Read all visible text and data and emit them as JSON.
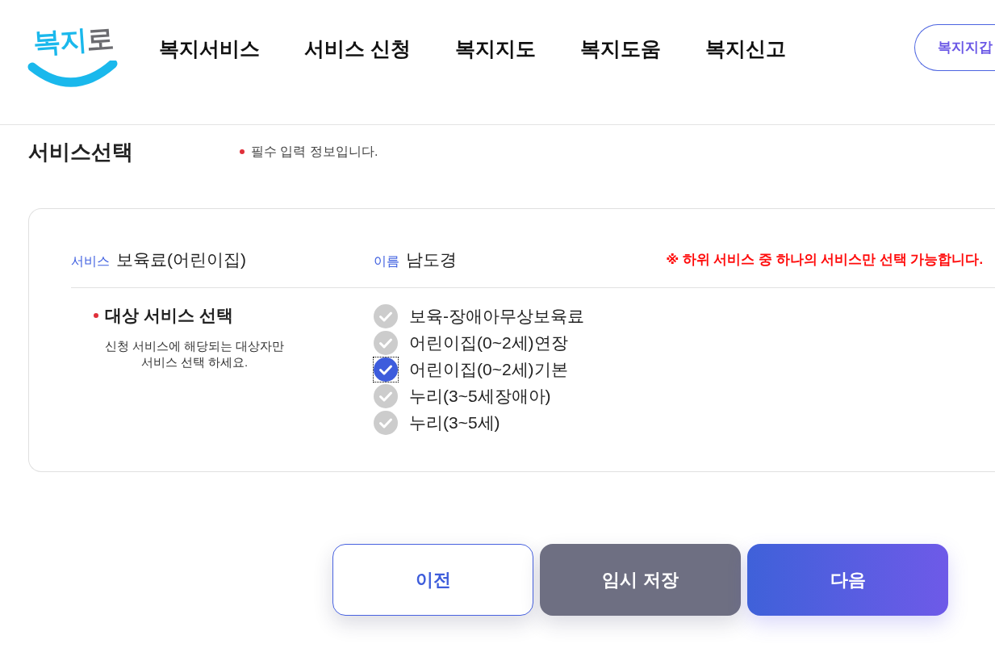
{
  "header": {
    "logo": {
      "text": "복지로"
    },
    "nav": [
      {
        "label": "복지서비스"
      },
      {
        "label": "서비스 신청"
      },
      {
        "label": "복지지도"
      },
      {
        "label": "복지도움"
      },
      {
        "label": "복지신고"
      }
    ],
    "wallet_button": {
      "label": "복지지갑"
    }
  },
  "section": {
    "title": "서비스선택",
    "required_note": "필수 입력 정보입니다."
  },
  "form": {
    "service_label": "서비스",
    "service_value": "보육료(어린이집)",
    "name_label": "이름",
    "name_value": "남도경",
    "notice": "※ 하위 서비스 중 하나의 서비스만 선택 가능합니다.",
    "target": {
      "title": "대상 서비스 선택",
      "required": true,
      "description": "신청 서비스에 해당되는 대상자만\n서비스 선택 하세요.",
      "options": [
        {
          "label": "보육-장애아무상보육료",
          "checked": false,
          "focused": false
        },
        {
          "label": "어린이집(0~2세)연장",
          "checked": false,
          "focused": false
        },
        {
          "label": "어린이집(0~2세)기본",
          "checked": true,
          "focused": true
        },
        {
          "label": "누리(3~5세장애아)",
          "checked": false,
          "focused": false
        },
        {
          "label": "누리(3~5세)",
          "checked": false,
          "focused": false
        }
      ]
    }
  },
  "buttons": [
    {
      "label": "이전",
      "kind": "outline"
    },
    {
      "label": "임시 저장",
      "kind": "secondary"
    },
    {
      "label": "다음",
      "kind": "primary"
    }
  ]
}
